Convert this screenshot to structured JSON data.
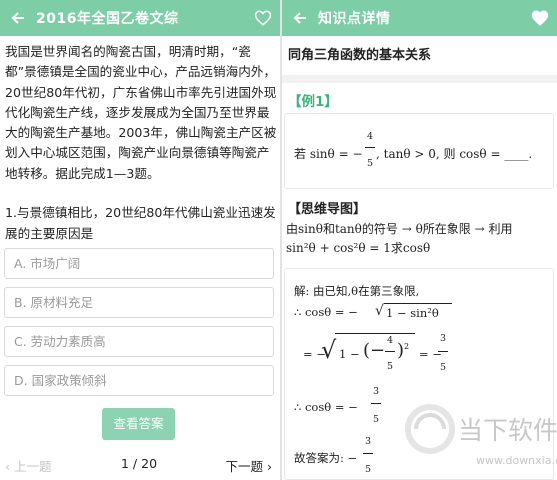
{
  "left": {
    "title": "2016年全国乙卷文综",
    "passage": "我国是世界闻名的陶瓷古国，明清时期，“瓷都”景德镇是全国的瓷业中心，产品远销海内外，20世纪80年代初，广东省佛山市率先引进国外现代化陶瓷生产线，逐步发展成为全国乃至世界最大的陶瓷生产基地。2003年，佛山陶瓷主产区被划入中心城区范围，陶瓷产业向景德镇等陶瓷产地转移。据此完成1—3题。",
    "question": "1.与景德镇相比，20世纪80年代佛山瓷业迅速发展的主要原因是",
    "options": [
      "A. 市场广阔",
      "B. 原材料充足",
      "C. 劳动力素质高",
      "D. 国家政策倾斜"
    ],
    "answer_button": "查看答案",
    "nav": {
      "prev": "上一题",
      "page": "1 / 20",
      "next": "下一题"
    }
  },
  "right": {
    "title": "知识点详情",
    "heading": "同角三角函数的基本关系",
    "example_label": "【例1】",
    "example": {
      "prefix": "若 sinθ = −",
      "num": "4",
      "den": "5",
      "suffix": ", tanθ > 0, 则 cosθ = ____."
    },
    "mind_label": "【思维导图】",
    "mind": {
      "line1": "由sinθ和tanθ的符号 → θ所在象限 → 利用",
      "line2": "sin²θ + cos²θ = 1求cosθ"
    },
    "solution": {
      "l1": "解: 由已知,θ在第三象限,",
      "l2a": "∴  cosθ = −",
      "l2b": "1 − sin²θ",
      "l3a": "= −",
      "l3b": "1 − ",
      "l3num": "4",
      "l3den": "5",
      "l3c": "= −",
      "l3num2": "3",
      "l3den2": "5",
      "l4a": "∴  cosθ = −",
      "l4num": "3",
      "l4den": "5",
      "l5a": "故答案为: −",
      "l5num": "3",
      "l5den": "5"
    },
    "watermark": {
      "cn": "当下软件园",
      "url": "www.downxia.com"
    }
  },
  "colors": {
    "topbar": "#7dcda7",
    "accent_green": "#3cb37a",
    "button": "#8cd2b3"
  }
}
